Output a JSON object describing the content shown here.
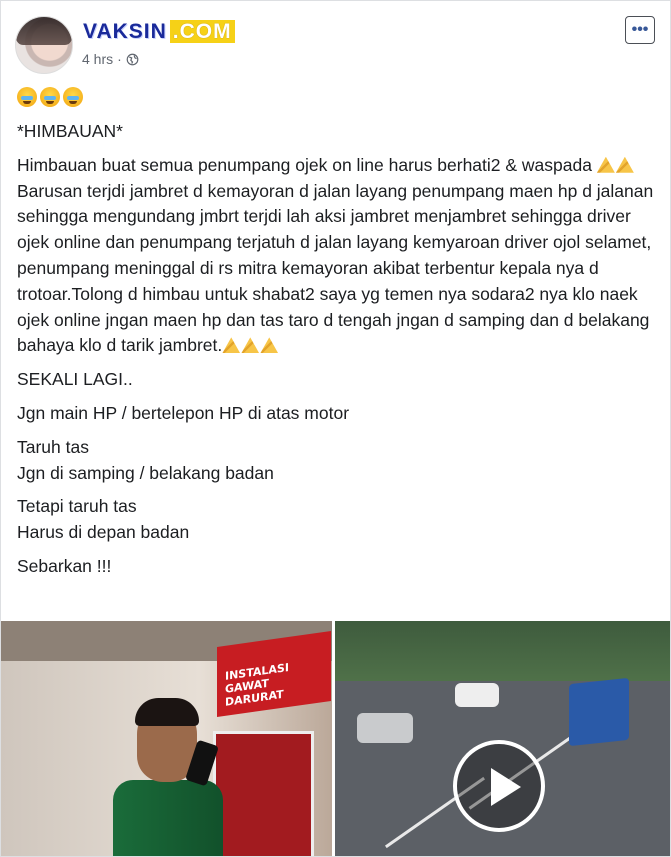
{
  "header": {
    "name_main": "VAKSIN",
    "name_suffix": ".COM",
    "time": "4 hrs",
    "dot": "·",
    "more_label": "•••"
  },
  "post": {
    "intro": "*HIMBAUAN*",
    "para1_a": "Himbauan buat semua penumpang ojek on line harus berhati2 & waspada",
    "para1_b": "Barusan terjdi jambret d kemayoran d jalan layang penumpang maen hp d jalanan sehingga mengundang jmbrt terjdi lah aksi jambret menjambret sehingga driver ojek online dan penumpang terjatuh d jalan layang kemyaroan driver ojol selamet, penumpang meninggal di rs mitra kemayoran akibat terbentur kepala nya d trotoar.Tolong d himbau untuk shabat2 saya yg temen nya sodara2 nya klo naek ojek online jngan maen hp dan tas taro d tengah jngan d samping dan d belakang bahaya klo d tarik jambret.",
    "sekali": "SEKALI LAGI..",
    "jgn_main": "Jgn main HP / bertelepon HP di atas motor",
    "taruh_tas": "Taruh tas",
    "jgn_samping": "Jgn di samping / belakang badan",
    "tetapi": "Tetapi taruh tas",
    "harus": "Harus di depan badan",
    "sebarkan": "Sebarkan !!!"
  },
  "media": {
    "sign_text": "INSTALASI GAWAT DARURAT"
  },
  "colors": {
    "name_blue": "#1a2a9a",
    "name_badge": "#f6d117",
    "meta_gray": "#616770",
    "link_blue": "#385898"
  }
}
